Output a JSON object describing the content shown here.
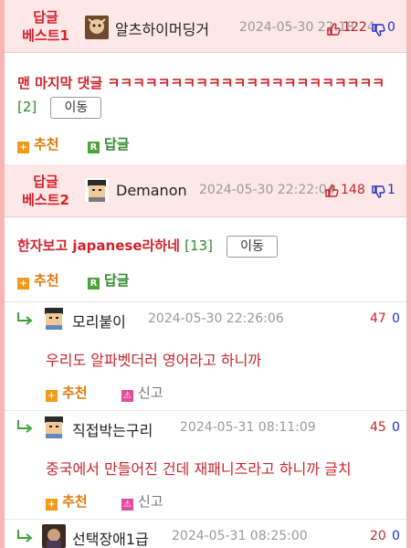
{
  "best1": {
    "tag_line1": "답글",
    "tag_line2": "베스트1",
    "nick": "알츠하이머딩거",
    "date": "2024-05-30 22:18:24",
    "up": "122",
    "down": "0",
    "text": "맨 마지막 댓글 ㅋㅋㅋㅋㅋㅋㅋㅋㅋㅋㅋㅋㅋㅋㅋㅋㅋㅋㅋㅋㅋㅋ",
    "count": "[2]",
    "move": "이동",
    "recommend": "추천",
    "reply": "답글"
  },
  "best2": {
    "tag_line1": "답글",
    "tag_line2": "베스트2",
    "nick": "Demanon",
    "date": "2024-05-30 22:22:04",
    "up": "148",
    "down": "1",
    "text": "한자보고 japanese라하네",
    "count": "[13]",
    "move": "이동",
    "recommend": "추천",
    "reply": "답글"
  },
  "replies": [
    {
      "nick": "모리붙이",
      "date": "2024-05-30 22:26:06",
      "up": "47",
      "down": "0",
      "text": "우리도 알파벳더러 영어라고 하니까",
      "recommend": "추천",
      "report": "신고"
    },
    {
      "nick": "직접박는구리",
      "date": "2024-05-31 08:11:09",
      "up": "45",
      "down": "0",
      "text": "중국에서 만들어진 건데 재패니즈라고 하니까 글치",
      "recommend": "추천",
      "report": "신고"
    },
    {
      "nick": "선택장애1급",
      "date": "2024-05-31 08:25:00",
      "up": "20",
      "down": "0"
    }
  ],
  "icons": {
    "plus": "+",
    "reply_badge": "R",
    "report_badge": "⚠"
  },
  "colors": {
    "accent_red": "#d5222b",
    "best_bg": "#fde7e7",
    "outer_bg": "#f6b6b6",
    "count_green": "#2e8a2e",
    "down_blue": "#2030c8"
  }
}
